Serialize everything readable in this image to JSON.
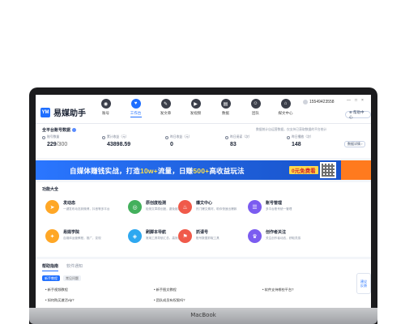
{
  "device": {
    "label": "MacBook"
  },
  "app": {
    "name": "易媒助手",
    "logo_text": "YM"
  },
  "nav": [
    {
      "label": "账号",
      "icon": "person-icon",
      "glyph": "◉",
      "active": false
    },
    {
      "label": "工作台",
      "icon": "workspace-icon",
      "glyph": "♥",
      "active": true
    },
    {
      "label": "发文章",
      "icon": "article-icon",
      "glyph": "✎",
      "active": false
    },
    {
      "label": "发视频",
      "icon": "video-icon",
      "glyph": "▶",
      "active": false
    },
    {
      "label": "数据",
      "icon": "data-icon",
      "glyph": "▤",
      "active": false
    },
    {
      "label": "团队",
      "icon": "team-icon",
      "glyph": "☺",
      "active": false
    },
    {
      "label": "媒文中心",
      "icon": "home-icon",
      "glyph": "⌂",
      "active": false
    }
  ],
  "user": {
    "phone": "15549423558"
  },
  "window_controls": [
    "—",
    "□",
    "×"
  ],
  "help_label": "⊕ 帮助中心",
  "stats": {
    "title": "全平台账号数据",
    "note": "数据统计自运营数据，仅支持已获取数据的平台统计",
    "items": [
      {
        "label": "账号数量",
        "value": "229",
        "sub": "/300"
      },
      {
        "label": "累计收益（元）",
        "value": "43898.59",
        "sub": ""
      },
      {
        "label": "昨日收益（元）",
        "value": "0",
        "sub": ""
      },
      {
        "label": "昨日阅读（次）",
        "value": "83",
        "sub": ""
      },
      {
        "label": "昨日播放（次）",
        "value": "148",
        "sub": ""
      }
    ],
    "detail_label": "数据详情 ›"
  },
  "banner": {
    "text_a": "自媒体赚钱实战，打造",
    "text_hl_a": "10w+",
    "text_b": "流量，日赚",
    "text_hl_b": "500+",
    "text_c": "高收益玩法",
    "cta": "0元免费看"
  },
  "functions": {
    "title": "功能大全",
    "cards": [
      {
        "title": "发动态",
        "desc": "一键发布动态到微博，抖音等多平台",
        "icon": "send-icon",
        "glyph": "➤",
        "color": "#ffa726"
      },
      {
        "title": "原创度检测",
        "desc": "检测文章原创度，避免被判搬运",
        "icon": "check-icon",
        "glyph": "◎",
        "color": "#43b05c"
      },
      {
        "title": "爆文中心",
        "desc": "热门爆文素材，助你快速出爆款",
        "icon": "fire-icon",
        "glyph": "♨",
        "color": "#f05a4a"
      },
      {
        "title": "账号管理",
        "desc": "多平台账号统一管理",
        "icon": "account-icon",
        "glyph": "☰",
        "color": "#7b5cf0"
      },
      {
        "title": "易媒学院",
        "desc": "自媒体运营教程，推广，变现",
        "icon": "academy-icon",
        "glyph": "✦",
        "color": "#ffa726"
      },
      {
        "title": "刷脚本导航",
        "desc": "常用工具导航汇总，高效创作",
        "icon": "navigation-icon",
        "glyph": "◈",
        "color": "#2ea8f0"
      },
      {
        "title": "抓请号",
        "desc": "账号数据抓取工具",
        "icon": "grab-icon",
        "glyph": "⚑",
        "color": "#f05a4a"
      },
      {
        "title": "创作者关注",
        "desc": "关注创作者动态，获取灵感",
        "icon": "creator-icon",
        "glyph": "♛",
        "color": "#7b5cf0"
      }
    ]
  },
  "bottom": {
    "tabs": [
      {
        "label": "帮助指南",
        "active": true
      },
      {
        "label": "软件通知",
        "active": false
      }
    ],
    "chips": [
      {
        "label": "新手教程",
        "active": true
      },
      {
        "label": "常见问题",
        "active": false
      }
    ],
    "links": [
      "• 新手视频教程",
      "• 新手图文教程",
      "• 软件支持哪些平台?",
      "• 如何购买激活vip?",
      "• 团队成员有权限吗?"
    ],
    "float_label_1": "建议",
    "float_label_2": "反馈"
  }
}
